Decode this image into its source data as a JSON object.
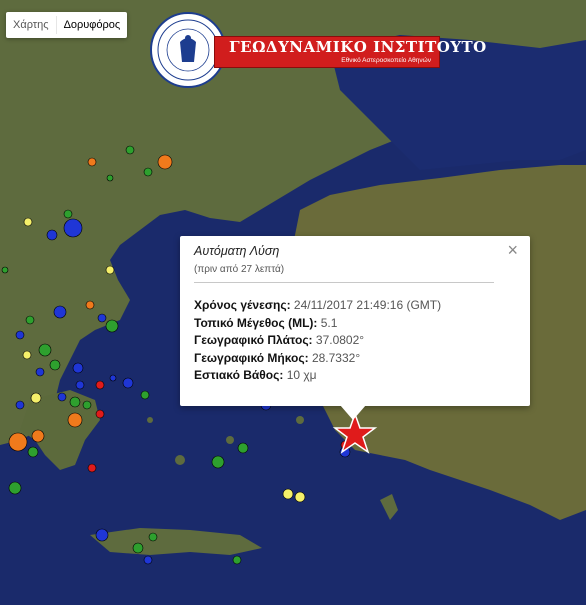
{
  "map": {
    "map_type_buttons": [
      {
        "label": "Χάρτης",
        "active": false
      },
      {
        "label": "Δορυφόρος",
        "active": true
      }
    ],
    "land_color": "#5e6b3e",
    "sea_color": "#1a2a6b",
    "epicenter_marker_color": "#e01b1b",
    "quake_colors": {
      "green": "#2ea02e",
      "blue": "#1f36d6",
      "red": "#e01b1b",
      "orange": "#f07a1c",
      "yellow": "#f5f06a"
    }
  },
  "logo": {
    "title": "ΓΕΩΔΥΝΑΜΙΚΟ ΙΝΣΤΙΤΟΥΤΟ",
    "subtitle": "Εθνικό Αστεροσκοπείο Αθηνών",
    "seal_text": "ΕΘΝΙΚΟΝ ΑΣΤΕΡΟΣΚΟΠΕΙΟΝ ΑΘΗΝΩΝ",
    "brand_color": "#d11d1d"
  },
  "popup": {
    "title": "Αυτόματη Λύση",
    "age": "(πριν από 27 λεπτά)",
    "close_symbol": "×",
    "rows": [
      {
        "label": "Χρόνος γένεσης:",
        "value": "24/11/2017  21:49:16 (GMT)"
      },
      {
        "label": "Τοπικό Μέγεθος (ML):",
        "value": "5.1"
      },
      {
        "label": "Γεωγραφικό Πλάτος:",
        "value": "37.0802°"
      },
      {
        "label": "Γεωγραφικό Μήκος:",
        "value": "28.7332°"
      },
      {
        "label": "Εστιακό Βάθος:",
        "value": "10 χμ"
      }
    ]
  }
}
